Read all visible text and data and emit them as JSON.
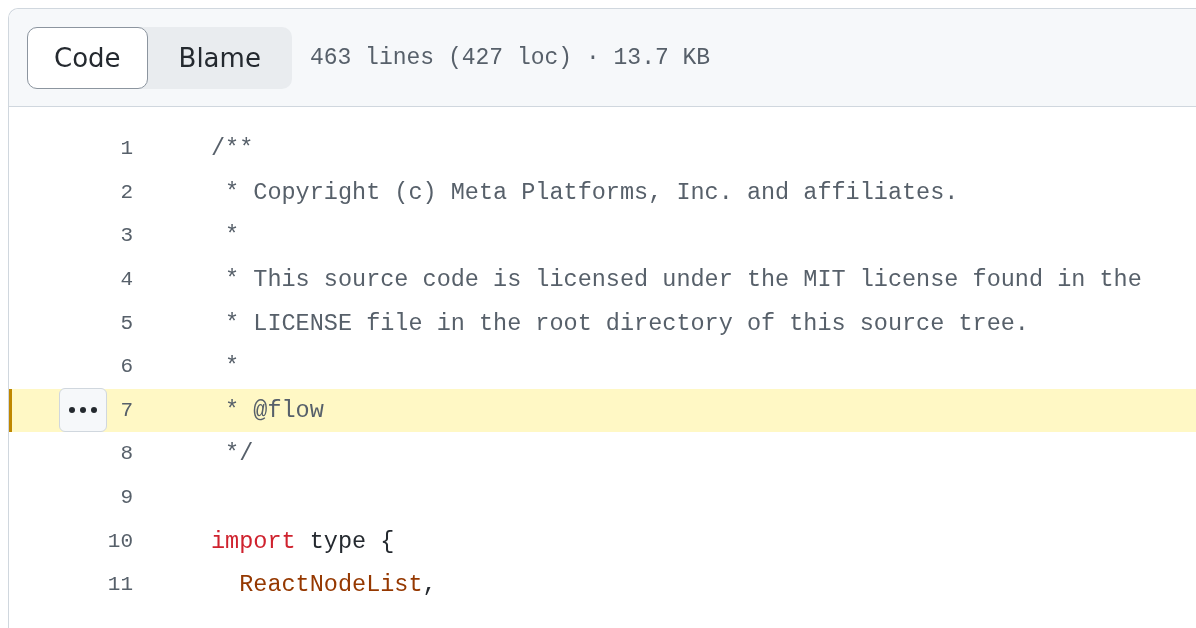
{
  "header": {
    "tabs": [
      {
        "label": "Code",
        "selected": true
      },
      {
        "label": "Blame",
        "selected": false
      }
    ],
    "file_info": "463 lines (427 loc) · 13.7 KB"
  },
  "lines": [
    {
      "number": "1",
      "highlighted": false,
      "tokens": [
        {
          "kind": "comment",
          "text": "/**"
        }
      ]
    },
    {
      "number": "2",
      "highlighted": false,
      "tokens": [
        {
          "kind": "comment",
          "text": " * Copyright (c) Meta Platforms, Inc. and affiliates."
        }
      ]
    },
    {
      "number": "3",
      "highlighted": false,
      "tokens": [
        {
          "kind": "comment",
          "text": " *"
        }
      ]
    },
    {
      "number": "4",
      "highlighted": false,
      "tokens": [
        {
          "kind": "comment",
          "text": " * This source code is licensed under the MIT license found in the"
        }
      ]
    },
    {
      "number": "5",
      "highlighted": false,
      "tokens": [
        {
          "kind": "comment",
          "text": " * LICENSE file in the root directory of this source tree."
        }
      ]
    },
    {
      "number": "6",
      "highlighted": false,
      "tokens": [
        {
          "kind": "comment",
          "text": " *"
        }
      ]
    },
    {
      "number": "7",
      "highlighted": true,
      "tokens": [
        {
          "kind": "comment",
          "text": " * @flow"
        }
      ]
    },
    {
      "number": "8",
      "highlighted": false,
      "tokens": [
        {
          "kind": "comment",
          "text": " */"
        }
      ]
    },
    {
      "number": "9",
      "highlighted": false
    },
    {
      "number": "10",
      "highlighted": false,
      "tokens": [
        {
          "kind": "keyword",
          "text": "import"
        },
        {
          "kind": "plain",
          "text": " type {"
        }
      ]
    },
    {
      "number": "11",
      "highlighted": false,
      "tokens": [
        {
          "kind": "identifier",
          "text": "  ReactNodeList"
        },
        {
          "kind": "plain",
          "text": ","
        }
      ]
    }
  ]
}
